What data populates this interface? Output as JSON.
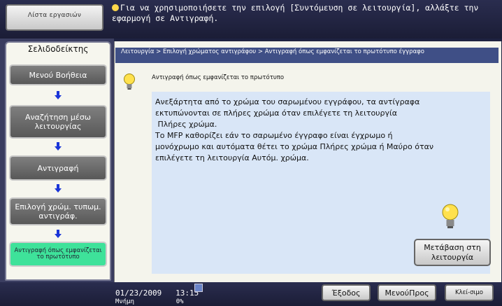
{
  "header": {
    "jobs_button": "Λίστα εργασιών",
    "message": "Για να χρησιμοποιήσετε την επιλογή [Συντόμευση σε λειτουργία], αλλάξτε την εφαρμογή σε Αντιγραφή."
  },
  "sidebar": {
    "title": "Σελιδοδείκτης",
    "items": [
      {
        "label": "Μενού Βοήθεια"
      },
      {
        "label": "Αναζήτηση μέσω λειτουργίας"
      },
      {
        "label": "Αντιγραφή"
      },
      {
        "label": "Επιλογή χρώμ. τυπωμ. αντιγράφ."
      },
      {
        "label": "Αντιγραφή όπως εμφανίζεται το πρωτότυπο"
      }
    ]
  },
  "main": {
    "breadcrumb": "Λειτουργία > Επιλογή χρώματος αντιγράφου > Αντιγραφή όπως εμφανίζεται το πρωτότυπο έγγραφο",
    "heading": "Αντιγραφή όπως εμφανίζεται το πρωτότυπο",
    "body_lines": [
      "Ανεξάρτητα από το χρώμα του σαρωμένου εγγράφου, τα αντίγραφα",
      "εκτυπώνονται σε πλήρες χρώμα όταν επιλέγετε τη λειτουργία",
      " Πλήρες χρώμα.",
      "Το MFP καθορίζει εάν το σαρωμένο έγγραφο είναι έγχρωμο ή",
      "μονόχρωμο και αυτόματα θέτει το χρώμα Πλήρες χρώμα ή Μαύρο όταν",
      "επιλέγετε τη λειτουργία Αυτόμ. χρώμα."
    ],
    "goto_button": "Μετάβαση στη λειτουργία"
  },
  "footer": {
    "date": "01/23/2009",
    "time": "13:15",
    "memory_label": "Μνήμη",
    "memory_value": "0%",
    "exit_button": "Έξοδος",
    "menu_button": "ΜενούΠρος",
    "close_button": "Κλεί-σιμο"
  },
  "colors": {
    "accent_active": "#3ee29a",
    "breadcrumb_bg": "#3f4f86",
    "content_bg": "#d9e6f7"
  }
}
